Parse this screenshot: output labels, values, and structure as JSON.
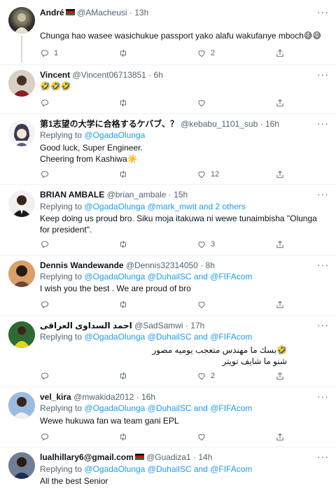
{
  "tweets": [
    {
      "name": "André",
      "handle": "@AMacheusi",
      "time": "13h",
      "reply_prefix": "",
      "mentions": "",
      "text": "Chunga hao wasee wasichukue passport yako alafu wakufanye mboch😅😅",
      "counts": {
        "reply": "1",
        "retweet": "",
        "like": "2"
      }
    },
    {
      "name": "Vincent",
      "handle": "@Vincent06713851",
      "time": "6h",
      "reply_prefix": "",
      "mentions": "",
      "text": "🤣🤣🤣",
      "counts": {
        "reply": "",
        "retweet": "",
        "like": ""
      }
    },
    {
      "name": "第1志望の大学に合格するケバブ、？",
      "handle": "@kebabu_1101_sub",
      "time": "16h",
      "reply_prefix": "Replying to",
      "mentions": "@OgadaOlunga",
      "text": "Good luck, Super Engineer.",
      "text2": "Cheering from Kashiwa☀️",
      "counts": {
        "reply": "",
        "retweet": "",
        "like": "12"
      }
    },
    {
      "name": "BRIAN AMBALE",
      "handle": "@brian_ambale",
      "time": "15h",
      "reply_prefix": "Replying to",
      "mentions": "@OgadaOlunga @mark_mwit and 2 others",
      "text": "Keep doing us proud bro. Siku moja itakuwa ni wewe tunaimbisha \"Olunga for president\".",
      "counts": {
        "reply": "",
        "retweet": "",
        "like": "3"
      }
    },
    {
      "name": "Dennis Wandewande",
      "handle": "@Dennis32314050",
      "time": "8h",
      "reply_prefix": "Replying to",
      "mentions": "@OgadaOlunga @DuhailSC and @FIFAcom",
      "text": "I wish you the best . We are proud of bro",
      "counts": {
        "reply": "",
        "retweet": "",
        "like": ""
      }
    },
    {
      "name": "احمد السداوى العراقى",
      "handle": "@SadSamwi",
      "time": "17h",
      "reply_prefix": "Replying to",
      "mentions": "@OgadaOlunga @DuhailSC and @FIFAcom",
      "text": "🤣بسك ما مهندس متعجب يوميه مصور",
      "text2": "شنو ما شايف تويتر",
      "counts": {
        "reply": "",
        "retweet": "",
        "like": "2"
      }
    },
    {
      "name": "vel_kira",
      "handle": "@mwakida2012",
      "time": "16h",
      "reply_prefix": "Replying to",
      "mentions": "@OgadaOlunga @DuhailSC and @FIFAcom",
      "text": "Wewe hukuwa fan wa team gani EPL",
      "counts": {
        "reply": "",
        "retweet": "",
        "like": ""
      }
    },
    {
      "name": "lualhillary6@gmail.com",
      "handle": "@Guadiza1",
      "time": "14h",
      "reply_prefix": "Replying to",
      "mentions": "@OgadaOlunga @DuhailSC and @FIFAcom",
      "text": "All the best Senior",
      "counts": {
        "reply": "",
        "retweet": "",
        "like": ""
      }
    }
  ],
  "dot": "·",
  "more": "···",
  "icons": {
    "reply": "reply-icon",
    "retweet": "retweet-icon",
    "like": "heart-icon",
    "share": "share-icon",
    "more": "more-icon"
  }
}
